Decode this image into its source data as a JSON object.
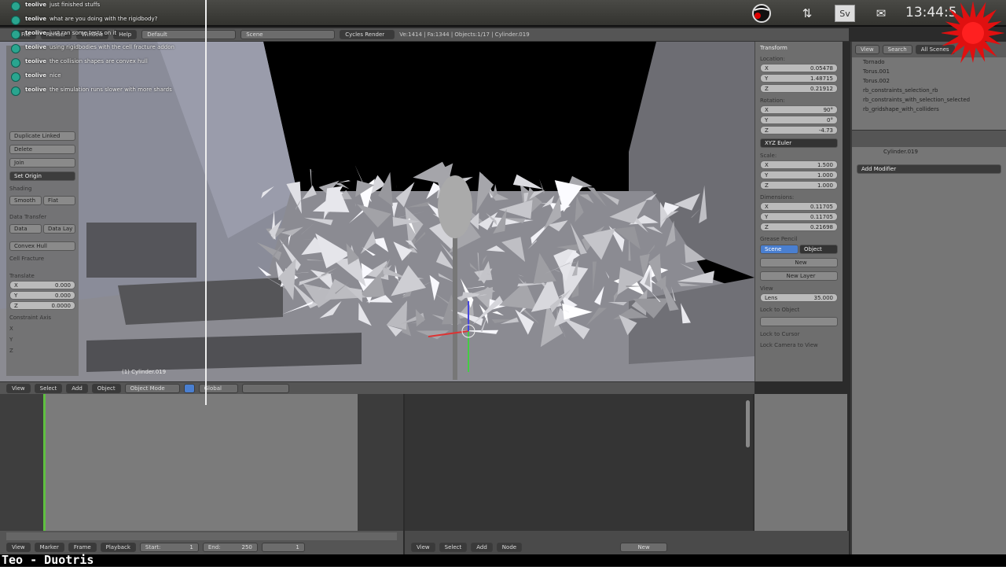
{
  "taskbar": {
    "clock": "13:44:5",
    "tray_icons": [
      "game-controller-icon",
      "network-arrows-icon",
      "sv-language-icon",
      "mail-icon"
    ],
    "sv_label": "Sv"
  },
  "info_header": {
    "menus": [
      "File",
      "Render",
      "Window",
      "Help"
    ],
    "layout": "Default",
    "scene": "Scene",
    "engine": "Cycles Render",
    "stats": "Ve:1414 | Fa:1344 | Objects:1/17 | Cylinder.019"
  },
  "chat": [
    {
      "user": "teolive",
      "text": "just finished stuffs"
    },
    {
      "user": "teolive",
      "text": "what are you doing with the rigidbody?"
    },
    {
      "user": "teolive",
      "text": "just ran some tests on it"
    },
    {
      "user": "teolive",
      "text": "using rigidbodies with the cell fracture addon"
    },
    {
      "user": "teolive",
      "text": "the collision shapes are convex hull"
    },
    {
      "user": "teolive",
      "text": "nice"
    },
    {
      "user": "teolive",
      "text": "the simulation runs slower with more shards"
    }
  ],
  "toolshelf": {
    "buttons": [
      "Duplicate Linked",
      "Delete",
      "Join",
      "Set Origin"
    ],
    "shading_label": "Shading",
    "shading": [
      "Smooth",
      "Flat"
    ],
    "history_label": "Data Transfer",
    "history": [
      "Data",
      "Data Lay"
    ],
    "extra": [
      "Convex Hull"
    ],
    "fracture": "Cell Fracture",
    "transform_label": "Translate",
    "vector": [
      [
        "X",
        "0.000"
      ],
      [
        "Y",
        "0.000"
      ],
      [
        "Z",
        "0.0000"
      ]
    ],
    "constraint_label": "Constraint Axis",
    "axes": [
      "X",
      "Y",
      "Z"
    ]
  },
  "viewport": {
    "object_label": "(1) Cylinder.019"
  },
  "npanel": {
    "title": "Transform",
    "location_label": "Location:",
    "location": [
      [
        "X",
        "0.05478"
      ],
      [
        "Y",
        "1.48715"
      ],
      [
        "Z",
        "0.21912"
      ]
    ],
    "rotation_label": "Rotation:",
    "rotation": [
      [
        "X",
        "90°"
      ],
      [
        "Y",
        "0°"
      ],
      [
        "Z",
        "-4.73"
      ]
    ],
    "mode": "XYZ Euler",
    "scale_label": "Scale:",
    "scale": [
      [
        "X",
        "1.500"
      ],
      [
        "Y",
        "1.000"
      ],
      [
        "Z",
        "1.000"
      ]
    ],
    "dim_label": "Dimensions:",
    "dimensions": [
      [
        "X",
        "0.11705"
      ],
      [
        "Y",
        "0.11705"
      ],
      [
        "Z",
        "0.21698"
      ]
    ],
    "grease": "Grease Pencil",
    "tabs": [
      "Scene",
      "Object"
    ],
    "new": "New",
    "new_layer": "New Layer",
    "view": "View",
    "lens": [
      "Lens",
      "35.000"
    ],
    "lock_label": "Lock to Object",
    "lock_cursor": "Lock to Cursor",
    "lock_camera": "Lock Camera to View"
  },
  "properties": {
    "tabs": [
      "View",
      "Search",
      "All Scenes"
    ],
    "outliner": [
      "Tornado",
      "Torus.001",
      "Torus.002",
      "rb_constraints_selection_rb",
      "rb_constraints_with_selection_selected",
      "rb_gridshape_with_colliders"
    ],
    "object": "Cylinder.019",
    "modifier": "Add Modifier"
  },
  "viewport_header": {
    "menus": [
      "View",
      "Select",
      "Add",
      "Object"
    ],
    "mode": "Object Mode",
    "orientation": "Global"
  },
  "timeline": {
    "menus": [
      "View",
      "Marker",
      "Frame",
      "Playback"
    ],
    "start_label": "Start:",
    "start": "1",
    "end_label": "End:",
    "end": "250",
    "current": "1"
  },
  "editor2": {
    "menus": [
      "View",
      "Select",
      "Add",
      "Node"
    ],
    "new": "New"
  },
  "caption": "Teo - Duotris"
}
